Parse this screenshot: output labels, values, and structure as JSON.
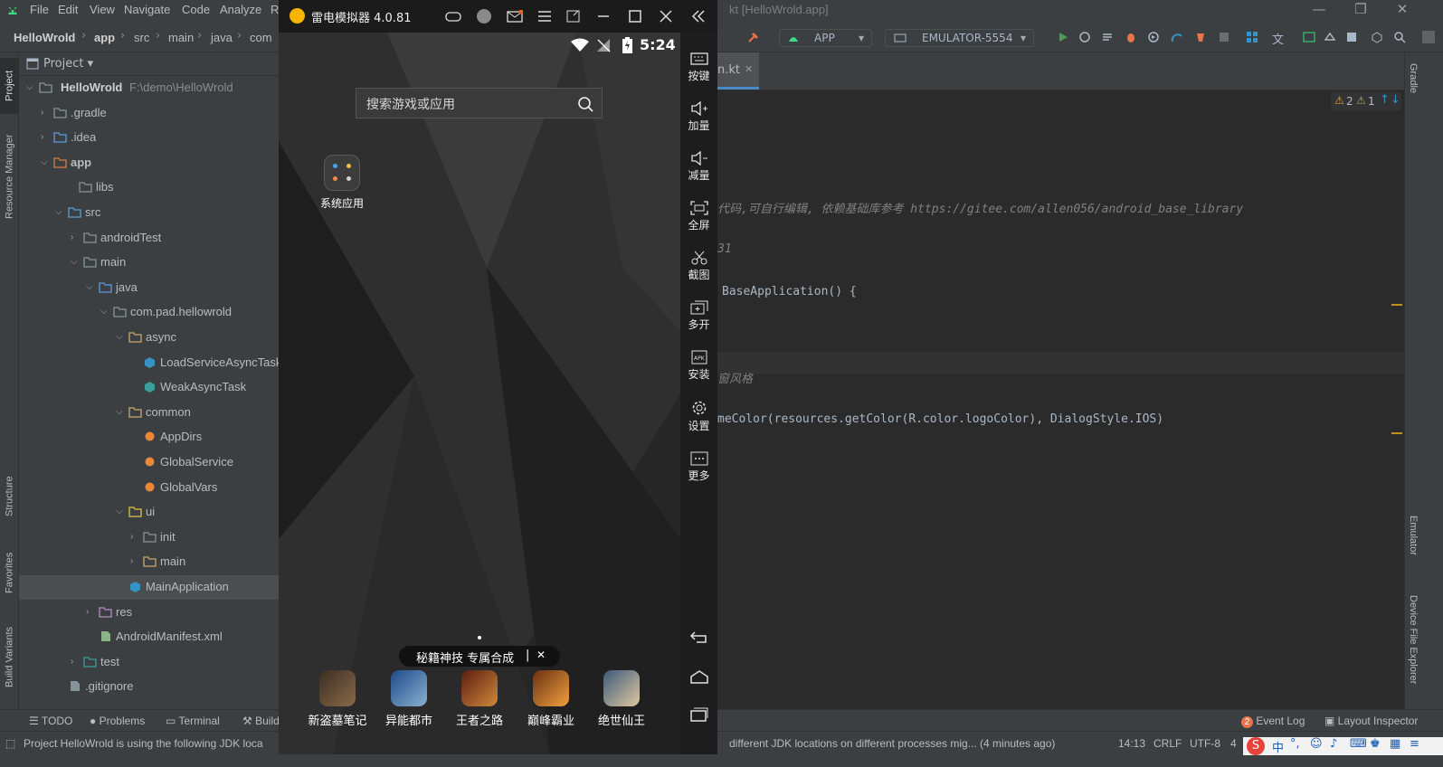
{
  "ide": {
    "menu": [
      "File",
      "Edit",
      "View",
      "Navigate",
      "Code",
      "Analyze",
      "R"
    ],
    "title": "kt [HelloWrold.app]",
    "breadcrumb": [
      "HelloWrold",
      "app",
      "src",
      "main",
      "java",
      "com"
    ],
    "run_config": "APP",
    "device": "EMULATOR-5554",
    "editor_tab": "n.kt",
    "inspections": {
      "warnings": "2",
      "weak_warnings": "1"
    },
    "code_lines": [
      {
        "text": "代码,可自行编辑, 依赖基础库参考 https://gitee.com/allen056/android_base_library",
        "kind": "comment"
      },
      {
        "text": "31",
        "kind": "comment"
      },
      {
        "text": "BaseApplication() {",
        "kind": "code"
      },
      {
        "text": "窗风格",
        "kind": "comment"
      },
      {
        "text": "meColor(resources.getColor(R.color.logoColor), DialogStyle.IOS)",
        "kind": "code"
      }
    ],
    "left_strip": [
      "Project",
      "Resource Manager",
      "Structure",
      "Favorites",
      "Build Variants"
    ],
    "right_strip": [
      "Gradle",
      "Emulator",
      "Device File Explorer"
    ],
    "project_panel": {
      "header": "Project",
      "root_name": "HelloWrold",
      "root_path": "F:\\demo\\HelloWrold",
      "items": [
        ".gradle",
        ".idea",
        "app",
        "libs",
        "src",
        "androidTest",
        "main",
        "java",
        "com.pad.hellowrold",
        "async",
        "LoadServiceAsyncTask",
        "WeakAsyncTask",
        "common",
        "AppDirs",
        "GlobalService",
        "GlobalVars",
        "ui",
        "init",
        "main",
        "MainApplication",
        "res",
        "AndroidManifest.xml",
        "test",
        ".gitignore"
      ]
    },
    "bottom_tools": [
      "TODO",
      "Problems",
      "Terminal",
      "Build"
    ],
    "bottom_right_tools": [
      "Event Log",
      "Layout Inspector"
    ],
    "event_badge": "2",
    "status": {
      "message": "Project HelloWrold is using the following JDK loca",
      "message_tail": "different JDK locations on different processes mig... (4 minutes ago)",
      "position": "14:13",
      "line_sep": "CRLF",
      "encoding": "UTF-8",
      "indent": "4"
    },
    "ime": "中"
  },
  "emulator": {
    "title": "雷电模拟器 4.0.81",
    "time": "5:24",
    "search_placeholder": "搜索游戏或应用",
    "folder_label": "系统应用",
    "banner_text": "秘籍神技 专属合成",
    "banner_close": "✕",
    "side_buttons": [
      "按键",
      "加量",
      "减量",
      "全屏",
      "截图",
      "多开",
      "安装",
      "设置",
      "更多"
    ],
    "games": [
      "新盗墓笔记",
      "异能都市",
      "王者之路",
      "巅峰霸业",
      "绝世仙王"
    ]
  },
  "colors": {
    "ide_bg": "#2b2b2b",
    "panel_bg": "#3c3f41",
    "comment": "#808080",
    "keyword": "#cc7832",
    "accent": "#3592c4"
  }
}
